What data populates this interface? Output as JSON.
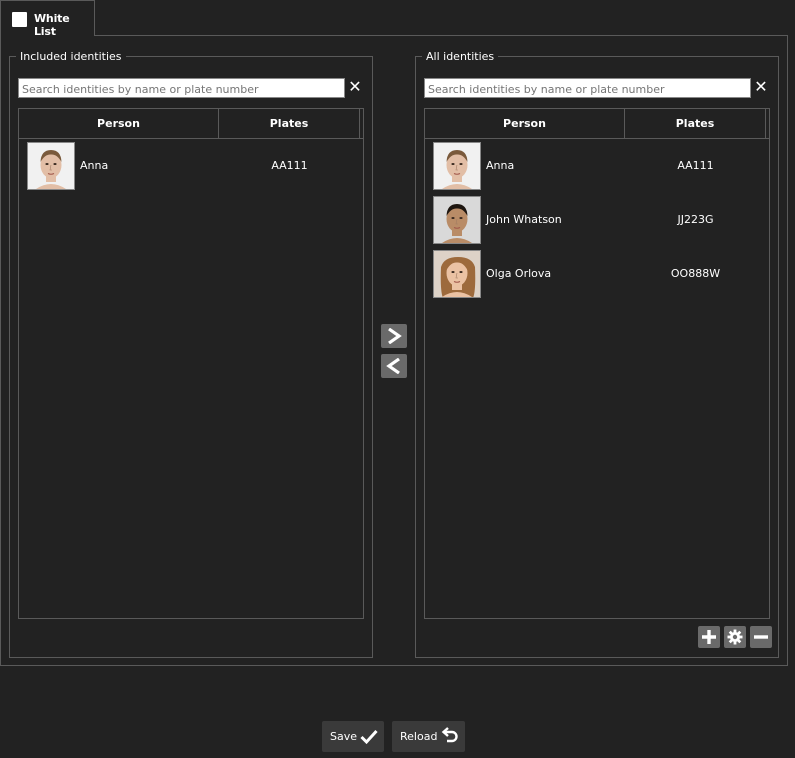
{
  "tab": {
    "title": "White List"
  },
  "included": {
    "legend": "Included identities",
    "search": {
      "placeholder": "Search identities by name or plate number",
      "value": "",
      "clear_icon": "close-icon"
    },
    "columns": [
      "Person",
      "Plates"
    ],
    "rows": [
      {
        "name": "Anna",
        "plate": "AA111",
        "photo": "face-anna"
      }
    ]
  },
  "all": {
    "legend": "All identities",
    "search": {
      "placeholder": "Search identities by name or plate number",
      "value": "",
      "clear_icon": "close-icon"
    },
    "columns": [
      "Person",
      "Plates"
    ],
    "rows": [
      {
        "name": "Anna",
        "plate": "AA111",
        "photo": "face-anna"
      },
      {
        "name": "John Whatson",
        "plate": "JJ223G",
        "photo": "face-john"
      },
      {
        "name": "Olga Orlova",
        "plate": "OO888W",
        "photo": "face-olga"
      }
    ]
  },
  "transfer": {
    "add_icon": "chevron-right-icon",
    "remove_icon": "chevron-left-icon"
  },
  "tools": {
    "add_icon": "plus-icon",
    "settings_icon": "gear-icon",
    "remove_icon": "minus-icon"
  },
  "footer": {
    "save_label": "Save",
    "save_icon": "checkmark-icon",
    "reload_label": "Reload",
    "reload_icon": "undo-icon"
  },
  "colors": {
    "background": "#222222",
    "border": "#5a5a5a",
    "button": "#6a6a6a",
    "footer_button": "#3a3a3a"
  }
}
